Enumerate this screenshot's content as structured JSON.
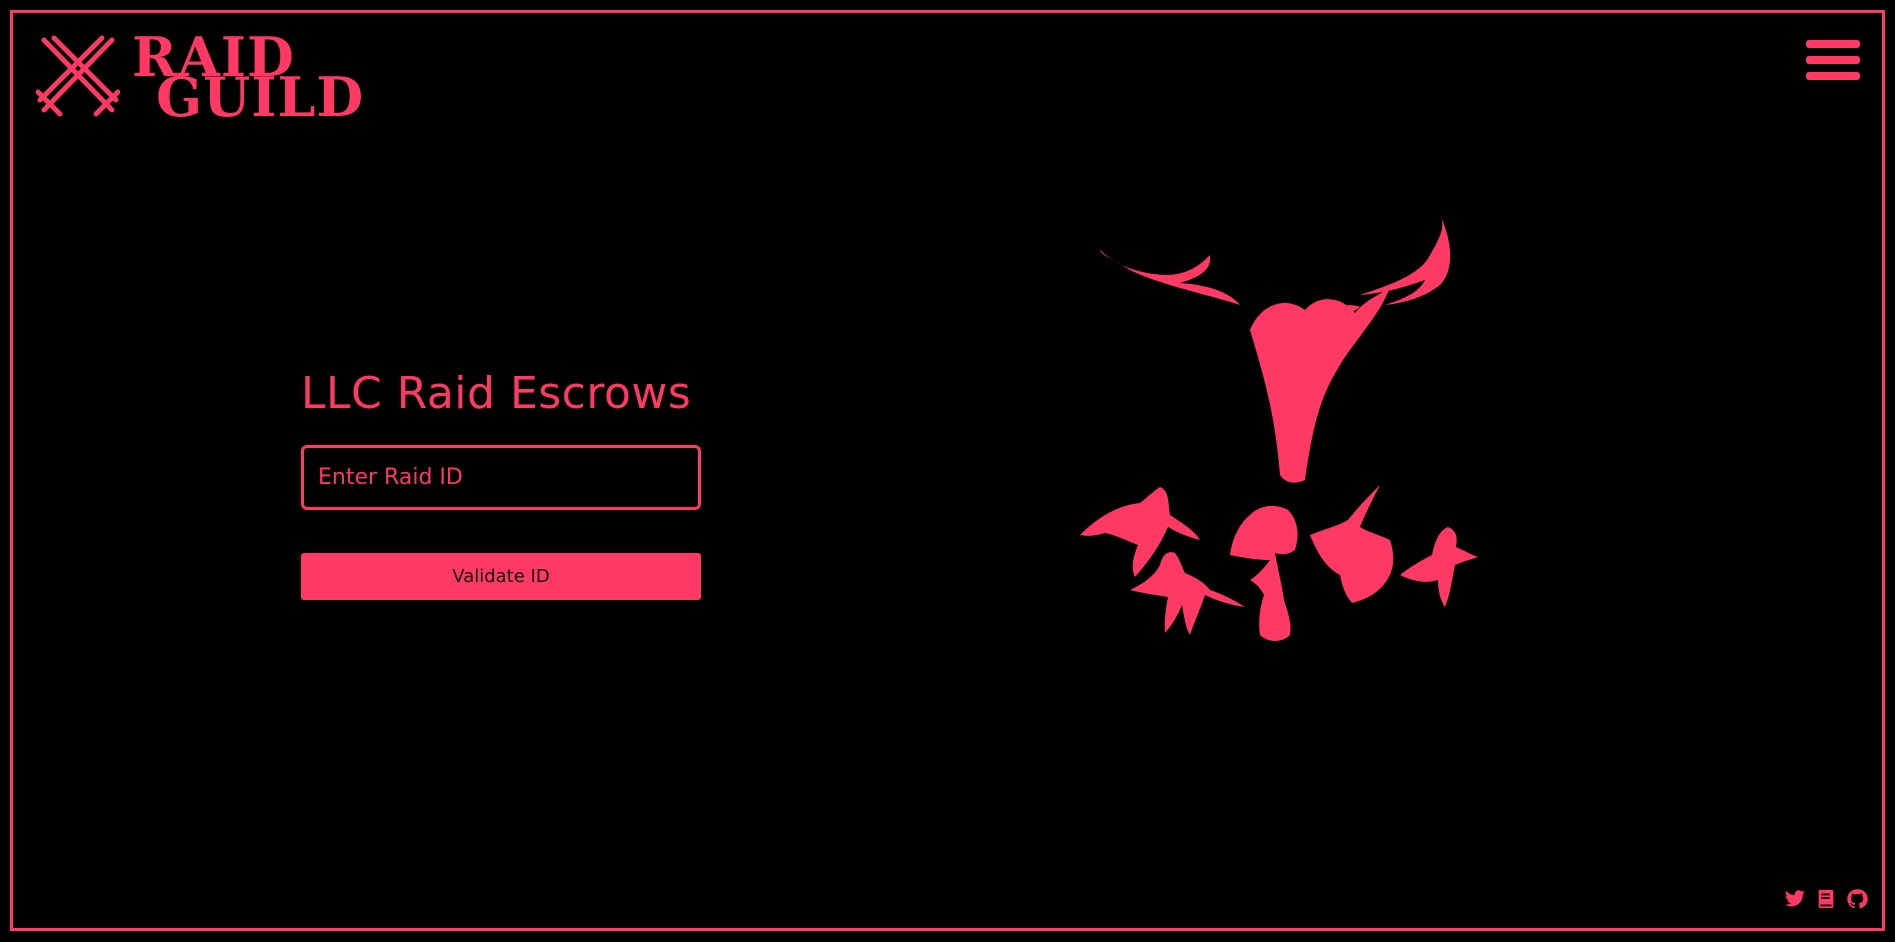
{
  "brand": {
    "line1": "RAID",
    "line2": "GUILD",
    "icon": "crossed-swords-icon"
  },
  "header": {
    "menu_icon": "hamburger-menu-icon"
  },
  "main": {
    "title": "LLC Raid Escrows",
    "raid_id_input": {
      "placeholder": "Enter Raid ID",
      "value": ""
    },
    "validate_label": "Validate ID",
    "illustration": "raid-party-illustration"
  },
  "footer": {
    "social": [
      {
        "name": "twitter-icon"
      },
      {
        "name": "book-icon"
      },
      {
        "name": "github-icon"
      }
    ]
  },
  "colors": {
    "accent": "#ff3864",
    "background": "#000000"
  }
}
